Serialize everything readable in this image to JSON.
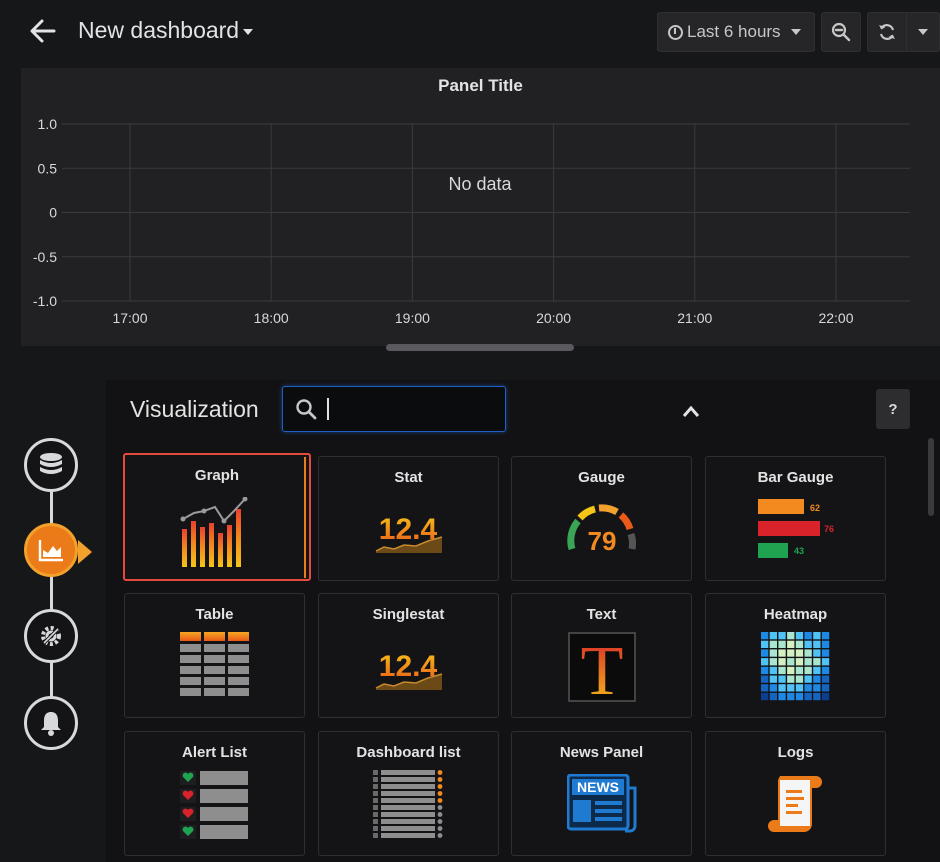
{
  "header": {
    "title": "New dashboard",
    "time_range": "Last 6 hours"
  },
  "panel": {
    "title": "Panel Title",
    "no_data": "No data"
  },
  "chart_data": {
    "type": "line",
    "title": "Panel Title",
    "x_ticks": [
      "17:00",
      "18:00",
      "19:00",
      "20:00",
      "21:00",
      "22:00"
    ],
    "y_ticks": [
      "1.0",
      "0.5",
      "0",
      "-0.5",
      "-1.0"
    ],
    "ylim": [
      -1.0,
      1.0
    ],
    "series": [],
    "grid": true,
    "annotation": "No data"
  },
  "visualization": {
    "label": "Visualization",
    "search_value": "",
    "help_label": "?",
    "cards": [
      {
        "name": "Graph"
      },
      {
        "name": "Stat",
        "preview_value": "12.4"
      },
      {
        "name": "Gauge",
        "preview_value": "79"
      },
      {
        "name": "Bar Gauge",
        "preview_values": [
          "62",
          "76",
          "43"
        ]
      },
      {
        "name": "Table"
      },
      {
        "name": "Singlestat",
        "preview_value": "12.4"
      },
      {
        "name": "Text",
        "preview_value": "T"
      },
      {
        "name": "Heatmap"
      },
      {
        "name": "Alert List"
      },
      {
        "name": "Dashboard list"
      },
      {
        "name": "News Panel",
        "preview_value": "NEWS"
      },
      {
        "name": "Logs"
      }
    ]
  },
  "colors": {
    "accent": "#eb7b18",
    "selected_border": "#e54b3c",
    "focus_blue": "#1f60c4",
    "background": "#161719"
  },
  "icons": {
    "rail": [
      "database-icon",
      "chart-area-icon",
      "settings-icon",
      "bell-icon"
    ]
  }
}
